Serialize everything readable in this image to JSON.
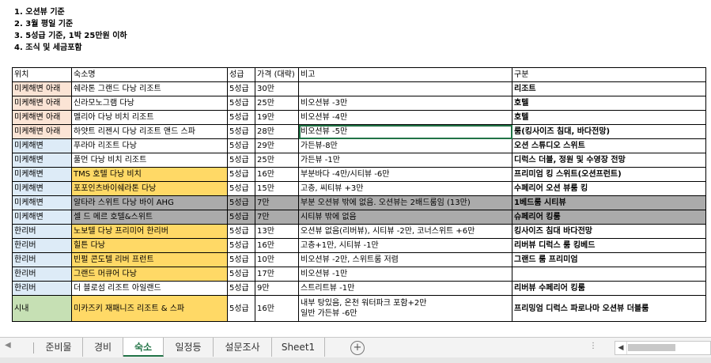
{
  "notes": [
    "1. 오션뷰 기준",
    "2. 3월 평일 기준",
    "3. 5성급 기준, 1박 25만원 이하",
    "4. 조식 및 세금포함"
  ],
  "headers": [
    "위치",
    "숙소명",
    "성급",
    "가격 (대략)",
    "비고",
    "구분"
  ],
  "rows": [
    {
      "loc": "미케해변 아래",
      "name": "쉐라톤 그랜드 다낭 리조트",
      "grade": "5성급",
      "price": "30만",
      "note": "",
      "type": "리조트",
      "loc_color": "#fbe4d5",
      "name_color": "#ffffff",
      "gray": false
    },
    {
      "loc": "미케해변 아래",
      "name": "신라모노그램 다낭",
      "grade": "5성급",
      "price": "25만",
      "note": "비오션뷰 -3만",
      "type": "호텔",
      "loc_color": "#fbe4d5",
      "name_color": "#ffffff",
      "gray": false
    },
    {
      "loc": "미케해변 아래",
      "name": "멜리아 다낭 비치 리조트",
      "grade": "5성급",
      "price": "19만",
      "note": "비오션뷰 -4만",
      "type": "호텔",
      "loc_color": "#fbe4d5",
      "name_color": "#ffffff",
      "gray": false
    },
    {
      "loc": "미케해변 아래",
      "name": "하얏트 리젠시 다낭 리조트 앤드 스파",
      "grade": "5성급",
      "price": "28만",
      "note": "비오션뷰 -5만",
      "type": "룸(킹사이즈 침대, 바다전망)",
      "loc_color": "#fbe4d5",
      "name_color": "#ffffff",
      "gray": false,
      "selected": true
    },
    {
      "loc": "미케해변",
      "name": "푸라마 리조트 다낭",
      "grade": "5성급",
      "price": "29만",
      "note": "가든뷰-8만",
      "type": "오션 스튜디오 스위트",
      "loc_color": "#ddebf7",
      "name_color": "#ffffff",
      "gray": false
    },
    {
      "loc": "미케해변",
      "name": "풀먼 다낭 비치 리조트",
      "grade": "5성급",
      "price": "25만",
      "note": "가든뷰 -1만",
      "type": "디럭스 더블, 정원 및 수영장 전망",
      "loc_color": "#ddebf7",
      "name_color": "#ffffff",
      "gray": false
    },
    {
      "loc": "미케해변",
      "name": "TMS 호텔 다낭 비치",
      "grade": "5성급",
      "price": "16만",
      "note": "부분바다 -4만/시티뷰 -6만",
      "type": "프리미엄 킹 스위트(오션프런트)",
      "loc_color": "#ddebf7",
      "name_color": "#ffd966",
      "gray": false
    },
    {
      "loc": "미케해변",
      "name": "포포인츠바이쉐라톤 다낭",
      "grade": "5성급",
      "price": "15만",
      "note": "고층, 씨티뷰 +3만",
      "type": "수페리어 오션 뷰룸 킹",
      "loc_color": "#ddebf7",
      "name_color": "#ffd966",
      "gray": false
    },
    {
      "loc": "미케해변",
      "name": "알타라 스위트 다낭 바이 AHG",
      "grade": "5성급",
      "price": "7만",
      "note": "부분 오션뷰 밖에 없음. 오션뷰는 2배드룸임 (13만)",
      "type": "1베드룸 시티뷰",
      "loc_color": "#ddebf7",
      "name_color": "#ababab",
      "gray": true
    },
    {
      "loc": "미케해변",
      "name": "셀 드 메르 호텔&스위트",
      "grade": "5성급",
      "price": "7만",
      "note": "시티뷰 밖에 없음",
      "type": "슈페리어 킹룸",
      "loc_color": "#ddebf7",
      "name_color": "#ababab",
      "gray": true
    },
    {
      "loc": "한리버",
      "name": "노보텔 다낭 프리미어 한리버",
      "grade": "5성급",
      "price": "13만",
      "note": "오션뷰 없음(리버뷰), 시티뷰 -2만, 코너스위트 +6만",
      "type": "킹사이즈 침대 바다전망",
      "loc_color": "#ddebf7",
      "name_color": "#ffd966",
      "gray": false
    },
    {
      "loc": "한리버",
      "name": "힐튼 다낭",
      "grade": "5성급",
      "price": "16만",
      "note": "고층+1만, 시티뷰 -1만",
      "type": "리버뷰 디럭스 룸 킹베드",
      "loc_color": "#ddebf7",
      "name_color": "#ffd966",
      "gray": false
    },
    {
      "loc": "한리버",
      "name": "빈펄 콘도텔 리버 프런트",
      "grade": "5성급",
      "price": "10만",
      "note": "비오션뷰 -2만, 스위트룸 저렴",
      "type": "그랜드 룸 프리미엄",
      "loc_color": "#ddebf7",
      "name_color": "#ffd966",
      "gray": false
    },
    {
      "loc": "한리버",
      "name": "그랜드 머큐어 다낭",
      "grade": "5성급",
      "price": "17만",
      "note": "비오션뷰 -1만",
      "type": "",
      "loc_color": "#ddebf7",
      "name_color": "#ffd966",
      "gray": false
    },
    {
      "loc": "한리버",
      "name": "더 블로섬 리조트 아일랜드",
      "grade": "5성급",
      "price": "9만",
      "note": "스트리트뷰 -1만",
      "type": "리버뷰 수페리어 킹룸",
      "loc_color": "#ddebf7",
      "name_color": "#ffffff",
      "gray": false
    },
    {
      "loc": "시내",
      "name": "미카즈키 재패니즈 리조트 & 스파",
      "grade": "5성급",
      "price": "16만",
      "note": "내부 탕있음, 온천 워터파크 포함+2만\n일반 가든뷰 -6만",
      "type": "프리밍엄 디럭스 파로나마 오션뷰 더블룸",
      "loc_color": "#c6e0b4",
      "name_color": "#ffd966",
      "gray": false,
      "tall": true
    }
  ],
  "tabs": [
    "준비물",
    "경비",
    "숙소",
    "일정등",
    "설문조사",
    "Sheet1"
  ],
  "active_tab": "숙소",
  "icons": {
    "add_sheet": "plus-circle-icon",
    "scroll_left": "chevron-left-icon",
    "more": "ellipsis-icon"
  }
}
